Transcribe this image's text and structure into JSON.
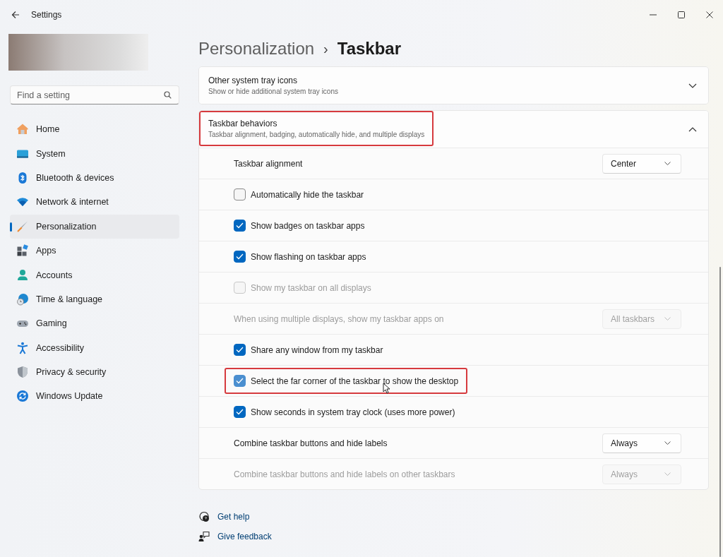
{
  "window": {
    "title": "Settings"
  },
  "sidebar": {
    "search": {
      "placeholder": "Find a setting"
    },
    "items": [
      {
        "label": "Home",
        "selected": false
      },
      {
        "label": "System",
        "selected": false
      },
      {
        "label": "Bluetooth & devices",
        "selected": false
      },
      {
        "label": "Network & internet",
        "selected": false
      },
      {
        "label": "Personalization",
        "selected": true
      },
      {
        "label": "Apps",
        "selected": false
      },
      {
        "label": "Accounts",
        "selected": false
      },
      {
        "label": "Time & language",
        "selected": false
      },
      {
        "label": "Gaming",
        "selected": false
      },
      {
        "label": "Accessibility",
        "selected": false
      },
      {
        "label": "Privacy & security",
        "selected": false
      },
      {
        "label": "Windows Update",
        "selected": false
      }
    ]
  },
  "breadcrumb": {
    "parent": "Personalization",
    "separator": "›",
    "current": "Taskbar"
  },
  "sections": [
    {
      "title": "Other system tray icons",
      "subtitle": "Show or hide additional system tray icons",
      "expanded": false,
      "highlighted": false
    },
    {
      "title": "Taskbar behaviors",
      "subtitle": "Taskbar alignment, badging, automatically hide, and multiple displays",
      "expanded": true,
      "highlighted": true,
      "rows": [
        {
          "kind": "dropdown",
          "label": "Taskbar alignment",
          "value": "Center",
          "disabled": false
        },
        {
          "kind": "checkbox",
          "label": "Automatically hide the taskbar",
          "checked": false,
          "disabled": false,
          "highlighted": false,
          "hovered": false
        },
        {
          "kind": "checkbox",
          "label": "Show badges on taskbar apps",
          "checked": true,
          "disabled": false,
          "highlighted": false,
          "hovered": false
        },
        {
          "kind": "checkbox",
          "label": "Show flashing on taskbar apps",
          "checked": true,
          "disabled": false,
          "highlighted": false,
          "hovered": false
        },
        {
          "kind": "checkbox",
          "label": "Show my taskbar on all displays",
          "checked": false,
          "disabled": true,
          "highlighted": false,
          "hovered": false
        },
        {
          "kind": "dropdown",
          "label": "When using multiple displays, show my taskbar apps on",
          "value": "All taskbars",
          "disabled": true
        },
        {
          "kind": "checkbox",
          "label": "Share any window from my taskbar",
          "checked": true,
          "disabled": false,
          "highlighted": false,
          "hovered": false
        },
        {
          "kind": "checkbox",
          "label": "Select the far corner of the taskbar to show the desktop",
          "checked": true,
          "disabled": false,
          "highlighted": true,
          "hovered": true
        },
        {
          "kind": "checkbox",
          "label": "Show seconds in system tray clock (uses more power)",
          "checked": true,
          "disabled": false,
          "highlighted": false,
          "hovered": false
        },
        {
          "kind": "dropdown",
          "label": "Combine taskbar buttons and hide labels",
          "value": "Always",
          "disabled": false
        },
        {
          "kind": "dropdown",
          "label": "Combine taskbar buttons and hide labels on other taskbars",
          "value": "Always",
          "disabled": true
        }
      ]
    }
  ],
  "footer_links": [
    "Get help",
    "Give feedback"
  ]
}
